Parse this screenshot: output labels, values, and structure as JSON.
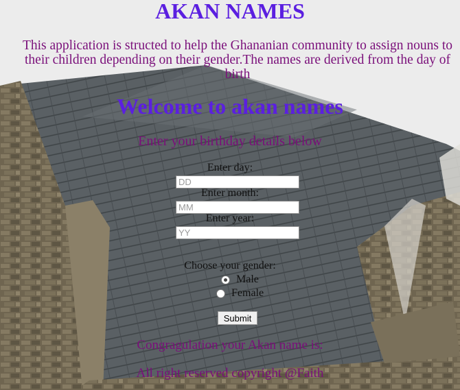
{
  "page": {
    "title": "AKAN NAMES",
    "intro": "This application is structed to help the Ghananian community to assign nouns to their children depending on their gender.The names are derived from the day of birth",
    "welcome": "Welcome to akan names",
    "subtitle": "Enter your birthday details below"
  },
  "form": {
    "day_label": "Enter day:",
    "day_placeholder": "DD",
    "month_label": "Enter month:",
    "month_placeholder": "MM",
    "year_label": "Enter year:",
    "year_placeholder": "YY",
    "gender_label": "Choose your gender:",
    "gender_options": [
      "Male",
      "Female"
    ],
    "selected_gender": "Male",
    "submit_label": "Submit"
  },
  "result_text": "Congragulation your Akan name is:",
  "footer": "All right reserved copyright @Faith",
  "colors": {
    "heading": "#5b1fe0",
    "text": "#7a0f7a"
  }
}
